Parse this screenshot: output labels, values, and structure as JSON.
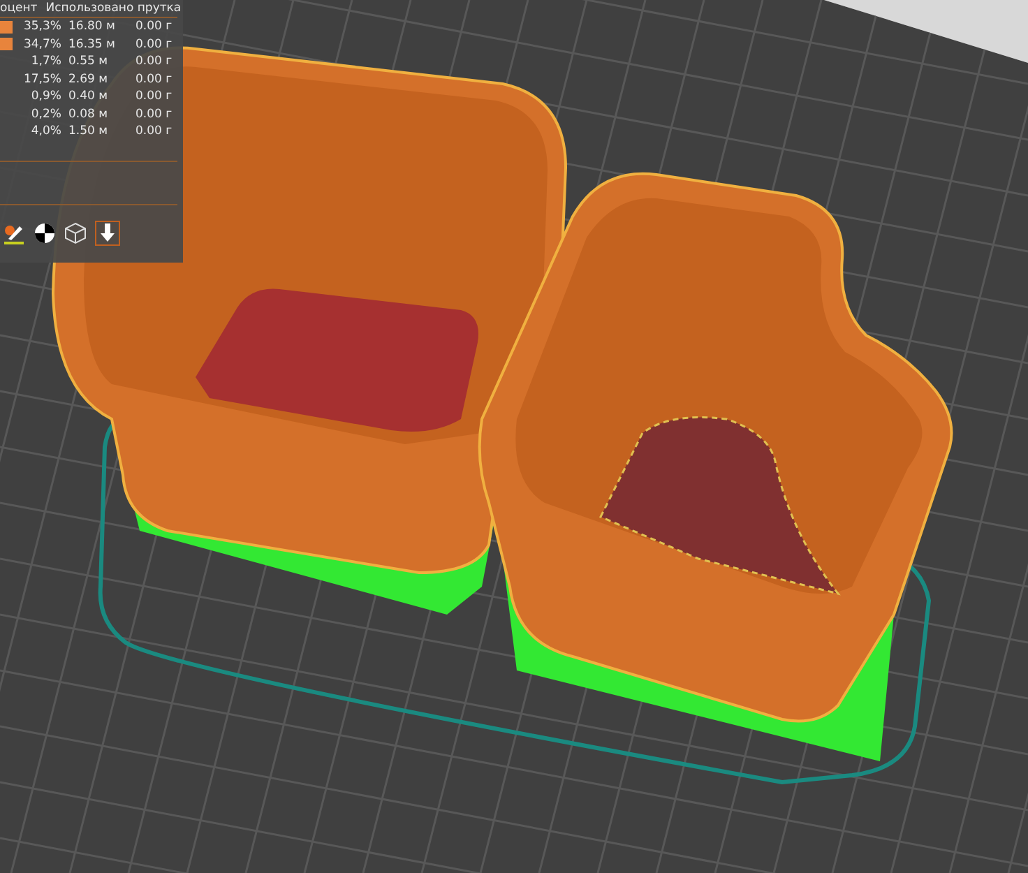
{
  "legend": {
    "columns": [
      "оцент",
      "Использовано прутка"
    ],
    "rows": [
      {
        "percent": "35,3%",
        "length": "16.80 м",
        "weight": "0.00 г",
        "color": "#e8843c"
      },
      {
        "percent": "34,7%",
        "length": "16.35 м",
        "weight": "0.00 г",
        "color": "#e8843c"
      },
      {
        "percent": "1,7%",
        "length": "0.55 м",
        "weight": "0.00 г"
      },
      {
        "percent": "17,5%",
        "length": "2.69 м",
        "weight": "0.00 г"
      },
      {
        "percent": "0,9%",
        "length": "0.40 м",
        "weight": "0.00 г"
      },
      {
        "percent": "0,2%",
        "length": "0.08 м",
        "weight": "0.00 г"
      },
      {
        "percent": "4,0%",
        "length": "1.50 м",
        "weight": "0.00 г"
      }
    ]
  }
}
